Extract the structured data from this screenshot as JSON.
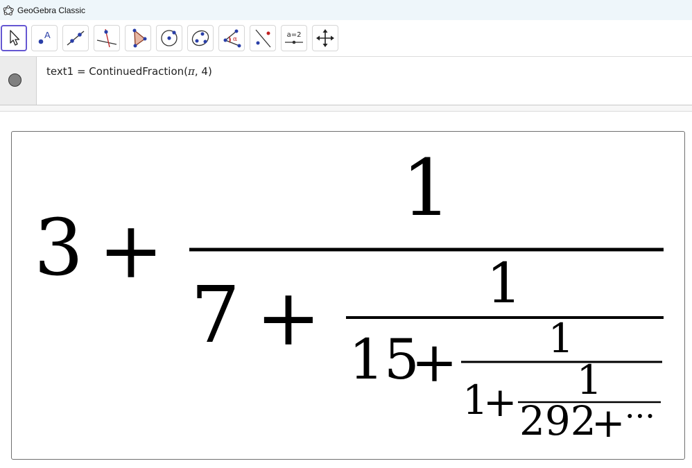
{
  "window": {
    "title": "GeoGebra Classic"
  },
  "toolbar": {
    "tools": [
      {
        "name": "move-tool-icon",
        "selected": true
      },
      {
        "name": "point-tool-icon"
      },
      {
        "name": "line-tool-icon"
      },
      {
        "name": "perpendicular-line-tool-icon"
      },
      {
        "name": "polygon-tool-icon"
      },
      {
        "name": "circle-with-center-tool-icon"
      },
      {
        "name": "ellipse-tool-icon"
      },
      {
        "name": "angle-tool-icon"
      },
      {
        "name": "reflect-about-line-tool-icon"
      },
      {
        "name": "slider-tool-icon",
        "label": "a=2"
      },
      {
        "name": "move-graphics-view-tool-icon"
      }
    ]
  },
  "algebra": {
    "entry": {
      "name": "text1",
      "equals": "=",
      "command": "ContinuedFraction(",
      "arg1": "π",
      "comma": ", ",
      "arg2": "4",
      "close": ")"
    }
  },
  "graphics": {
    "continued_fraction": {
      "a0": "3",
      "a1": "7",
      "a2": "15",
      "a3": "1",
      "a4": "292",
      "numerator": "1",
      "plus": "+",
      "ellipsis": "···"
    }
  }
}
